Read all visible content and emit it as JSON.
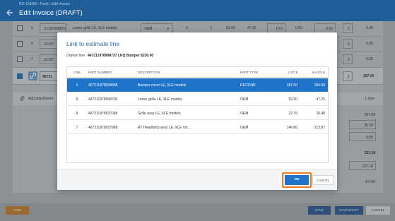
{
  "header": {
    "breadcrumb": "RO 123456 › Parts › Edit Invoice",
    "title": "Edit Invoice (DRAFT)"
  },
  "background": {
    "rows": [
      {
        "num": "5",
        "part": "..211978998700",
        "desc": "Lower grille LE, XLE models",
        "type": "OEM",
        "qty": "0",
        "qty2": "1",
        "list": "52.50",
        "net": "47.25",
        "pct": "10.0",
        "disc": "0.00",
        "ext": "0.00",
        "q3": "0",
        "total": "0.00"
      },
      {
        "num": "6",
        "part": "..21197",
        "desc": "",
        "type": "",
        "qty": "",
        "qty2": "",
        "list": "",
        "net": "",
        "pct": "",
        "disc": "",
        "ext": "",
        "q3": "0",
        "total": "0.00"
      },
      {
        "num": "7",
        "part": "..21197",
        "desc": "",
        "type": "",
        "qty": "",
        "qty2": "",
        "list": "",
        "net": "",
        "pct": "",
        "disc": "",
        "ext": "",
        "q3": "0",
        "total": "0.00"
      },
      {
        "num": "",
        "part": "46721",
        "desc": "",
        "type": "",
        "qty": "",
        "qty2": "",
        "list": "",
        "net": "",
        "pct": "",
        "disc": "",
        "ext": "",
        "q3": "1",
        "total": "257.00"
      }
    ],
    "attachment_label": "Add attachment",
    "attachment_count": "1 item",
    "totals": [
      "207.00",
      "20.18",
      "0.00",
      "227.18",
      "227.18",
      "$ 0.00"
    ],
    "buttons": {
      "void": "VOID",
      "save": "SAVE",
      "save_draft": "SAVE DRAFT",
      "cancel": "CANCEL"
    }
  },
  "modal": {
    "title": "Link to estimate line",
    "orphan_label": "Orphan line:",
    "orphan_value": "467211978998737  LKQ  Bumper  $230.00",
    "columns": {
      "line": "LINE",
      "part": "PART NUMBER",
      "desc": "DESCRIPTION",
      "type": "PART TYPE",
      "list": "LIST $",
      "sales": "SALES $"
    },
    "rows": [
      {
        "line": "3",
        "part": "467211978939898",
        "desc": "Bumper cover LE, XLE models",
        "type": "RECOND",
        "list": "287.00",
        "sales": "255.99",
        "selected": true
      },
      {
        "line": "5",
        "part": "467211978998700",
        "desc": "Lower grille LE, XLE models",
        "type": "OEM",
        "list": "52.50",
        "sales": "47.25",
        "selected": false
      },
      {
        "line": "6",
        "part": "467211978937098",
        "desc": "Grille assy LE, XLE models",
        "type": "OEM",
        "list": "22.76",
        "sales": "20.48",
        "selected": false
      },
      {
        "line": "7",
        "part": "467211978937998",
        "desc": "RT Headlamp assy LE, XLE mo...",
        "type": "OEM",
        "list": "246.86",
        "sales": "213.87",
        "selected": false
      }
    ],
    "ok_label": "OK",
    "cancel_label": "CANCEL"
  },
  "colors": {
    "accent": "#1f73c9",
    "header": "#1f5e98",
    "highlight": "#f07d1a",
    "void": "#9b6a33"
  }
}
